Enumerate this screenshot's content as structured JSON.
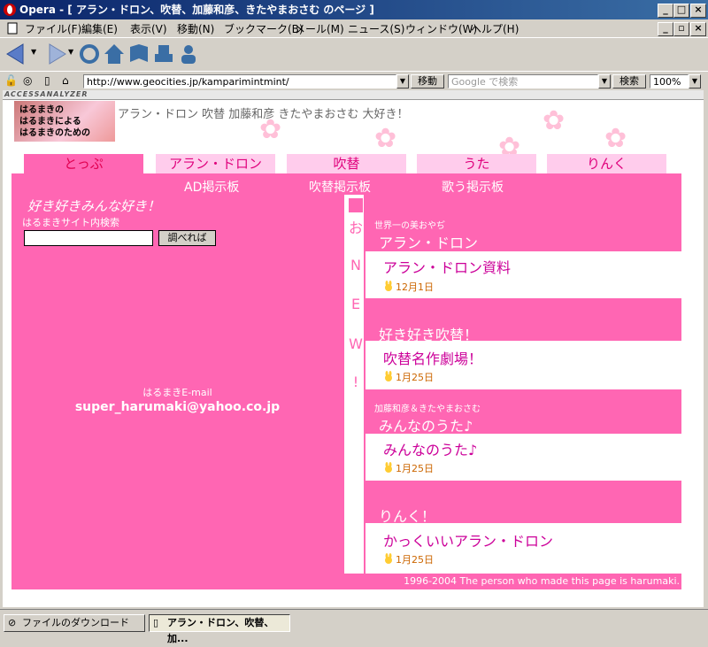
{
  "window": {
    "title": "Opera - [ アラン・ドロン、吹替、加藤和彦、きたやまおさむ のページ ]",
    "minimize": "_",
    "maximize": "□",
    "close": "×"
  },
  "menu": [
    "ファイル(F)",
    "編集(E)",
    "表示(V)",
    "移動(N)",
    "ブックマーク(B)",
    "メール(M)",
    "ニュース(S)",
    "ウィンドウ(W)",
    "ヘルプ(H)"
  ],
  "address": {
    "url": "http://www.geocities.jp/kamparimintmint/",
    "go_label": "移動",
    "search_placeholder": "Google で検索",
    "search_label": "検索",
    "zoom": "100%"
  },
  "page": {
    "analyzer": "ACCESSANALYZER",
    "logo_lines": [
      "はるまきの",
      "はるまきによる",
      "はるまきのための"
    ],
    "headline": "アラン・ドロン 吹替 加藤和彦 きたやまおさむ 大好き！",
    "tabs": [
      "とっぷ",
      "アラン・ドロン",
      "吹替",
      "うた",
      "りんく"
    ],
    "sublinks": [
      "AD掲示板",
      "吹替掲示板",
      "歌う掲示板"
    ],
    "slogan": "好き好きみんな好き！",
    "search_label": "はるまきサイト内検索",
    "search_button": "調べれば",
    "email_label": "はるまきE-mail",
    "email": "super_harumaki@yahoo.co.jp",
    "new_chars": [
      "お",
      "N",
      "E",
      "W",
      "!"
    ],
    "news": [
      {
        "subtitle": "世界一の美おやぢ",
        "title": "アラン・ドロン",
        "link": "アラン・ドロン資料",
        "date": "12月1日"
      },
      {
        "subtitle": "",
        "title": "好き好き吹替！",
        "link": "吹替名作劇場！",
        "date": "1月25日"
      },
      {
        "subtitle": "加藤和彦＆きたやまおさむ",
        "title": "みんなのうた♪",
        "link": "みんなのうた♪",
        "date": "1月25日"
      },
      {
        "subtitle": "",
        "title": "りんく！",
        "link": "かっくいいアラン・ドロン",
        "date": "1月25日"
      }
    ],
    "copyright": "1996-2004  The person who made this page is harumaki."
  },
  "statusbar": {
    "tabs": [
      "ファイルのダウンロード",
      "アラン・ドロン、吹替、加..."
    ]
  },
  "colors": {
    "pink": "#ff66b3",
    "light_pink": "#ffccec",
    "link_pink": "#cc0099"
  }
}
